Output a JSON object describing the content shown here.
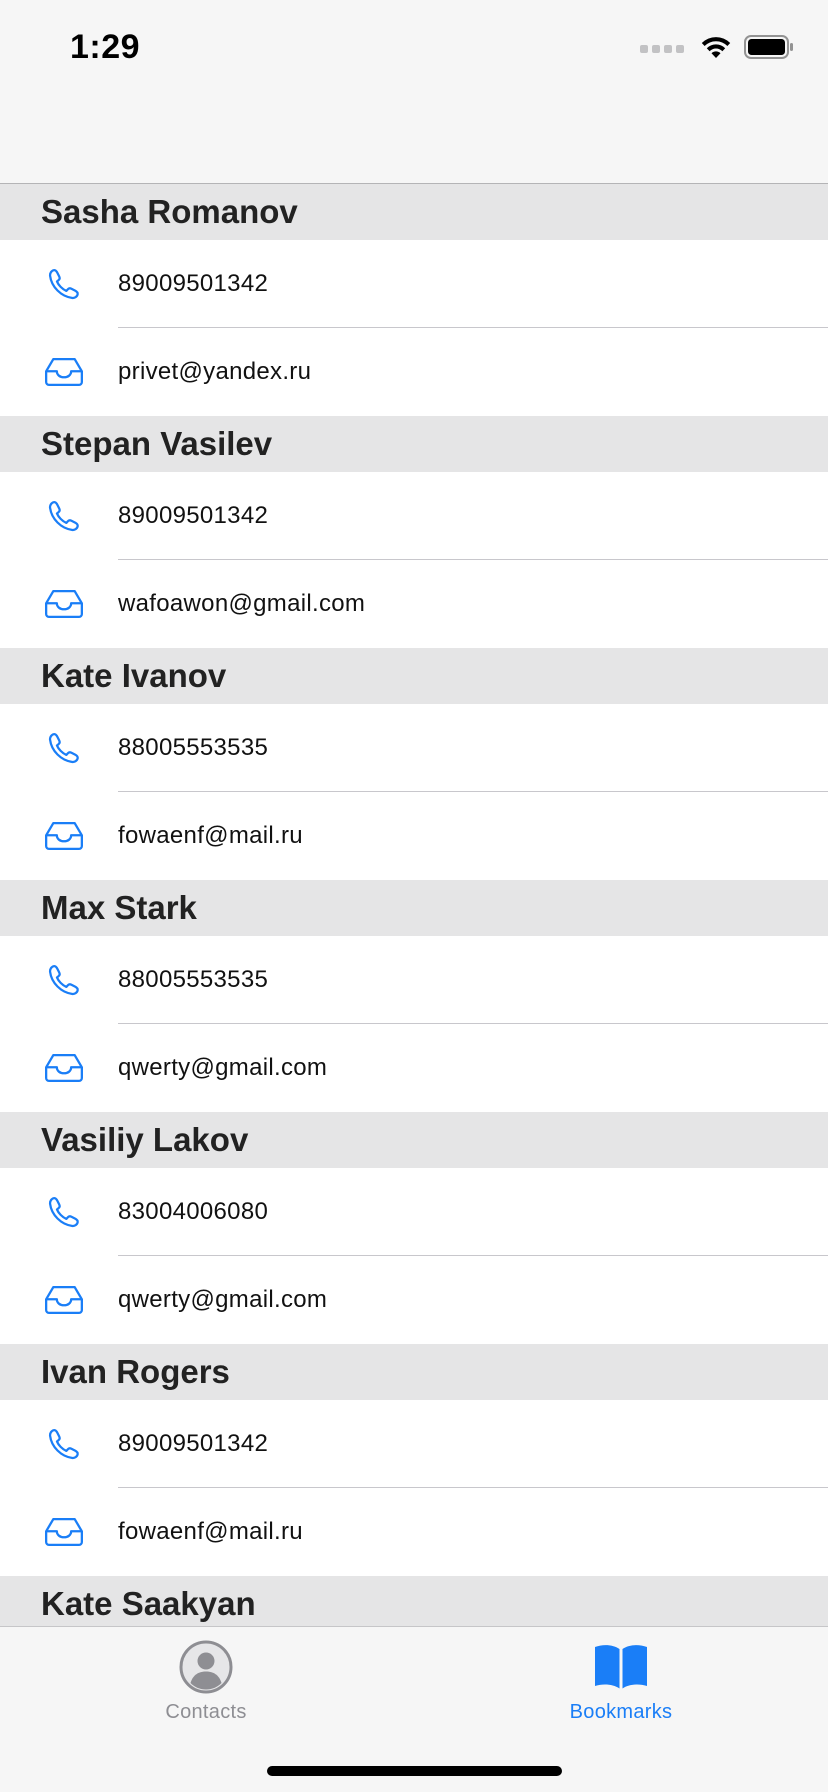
{
  "status_bar": {
    "time": "1:29"
  },
  "contacts": [
    {
      "name": "Sasha Romanov",
      "phone": "89009501342",
      "email": "privet@yandex.ru"
    },
    {
      "name": "Stepan Vasilev",
      "phone": "89009501342",
      "email": "wafoawon@gmail.com"
    },
    {
      "name": "Kate Ivanov",
      "phone": "88005553535",
      "email": "fowaenf@mail.ru"
    },
    {
      "name": "Max Stark",
      "phone": "88005553535",
      "email": "qwerty@gmail.com"
    },
    {
      "name": "Vasiliy Lakov",
      "phone": "83004006080",
      "email": "qwerty@gmail.com"
    },
    {
      "name": "Ivan Rogers",
      "phone": "89009501342",
      "email": "fowaenf@mail.ru"
    },
    {
      "name": "Kate Saakyan"
    }
  ],
  "tab_bar": {
    "tabs": [
      {
        "label": "Contacts",
        "icon": "person-circle-icon",
        "selected": false
      },
      {
        "label": "Bookmarks",
        "icon": "book-icon",
        "selected": true
      }
    ]
  },
  "colors": {
    "accent": "#1a7ef7",
    "inactive": "#8e8e93",
    "section_header_bg": "#e5e5e6",
    "bar_bg": "#f6f6f6"
  }
}
